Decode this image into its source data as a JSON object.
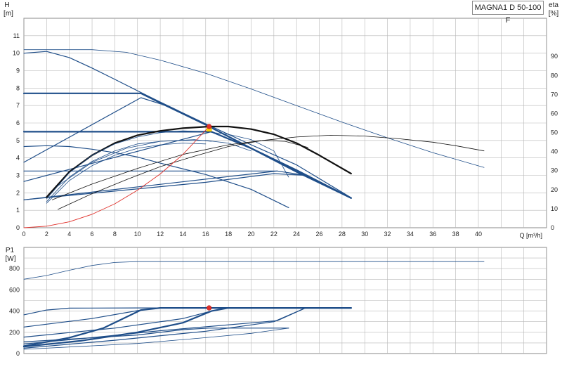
{
  "title": "MAGNA1 D 50-100 F",
  "colors": {
    "grid": "#b8b8b8",
    "axis": "#333333",
    "curve_blue": "#1f4e89",
    "curve_black": "#111111",
    "system_curve": "#e0302a",
    "duty_point": "#e0302a",
    "duty_point_inner": "#ffd400"
  },
  "chart_data": [
    {
      "type": "line",
      "name": "head-chart",
      "xlabel": "Q [m³/h]",
      "ylabel_top": "H",
      "ylabel_unit": "[m]",
      "y2label_top": "eta",
      "y2label_unit": "[%]",
      "xlim": [
        0,
        46
      ],
      "ylim": [
        0,
        12
      ],
      "y2lim": [
        0,
        110
      ],
      "x_ticks": [
        0,
        2,
        4,
        6,
        8,
        10,
        12,
        14,
        16,
        18,
        20,
        22,
        24,
        26,
        28,
        30,
        32,
        34,
        36,
        38,
        40
      ],
      "y_ticks": [
        0,
        1,
        2,
        3,
        4,
        5,
        6,
        7,
        8,
        9,
        10,
        11
      ],
      "y2_ticks": [
        0,
        10,
        20,
        30,
        40,
        50,
        60,
        70,
        80,
        90
      ],
      "grid": true,
      "series": [
        {
          "role": "head",
          "style": "thin",
          "points": [
            [
              0,
              10.2
            ],
            [
              6,
              10.2
            ],
            [
              9,
              10.05
            ],
            [
              12,
              9.6
            ],
            [
              16,
              8.85
            ],
            [
              20,
              7.95
            ],
            [
              24,
              7.0
            ],
            [
              28,
              6.05
            ],
            [
              32,
              5.15
            ],
            [
              36,
              4.3
            ],
            [
              40.5,
              3.45
            ]
          ]
        },
        {
          "role": "head",
          "style": "normal",
          "points": [
            [
              0,
              10.0
            ],
            [
              2,
              10.1
            ],
            [
              4,
              9.75
            ],
            [
              6,
              9.15
            ],
            [
              8,
              8.5
            ],
            [
              10,
              7.85
            ],
            [
              12,
              7.2
            ],
            [
              16,
              5.95
            ],
            [
              20,
              4.75
            ],
            [
              24,
              3.6
            ],
            [
              28.8,
              1.72
            ]
          ]
        },
        {
          "role": "head",
          "style": "normal",
          "points": [
            [
              0,
              4.65
            ],
            [
              2,
              4.7
            ],
            [
              4,
              4.65
            ],
            [
              6,
              4.5
            ],
            [
              8,
              4.3
            ],
            [
              10,
              4.05
            ],
            [
              12,
              3.7
            ],
            [
              16,
              3.05
            ],
            [
              20,
              2.2
            ],
            [
              23.3,
              1.15
            ]
          ]
        },
        {
          "role": "const-pressure",
          "style": "thick",
          "points": [
            [
              0,
              7.7
            ],
            [
              10.3,
              7.7
            ],
            [
              12.5,
              7.0
            ],
            [
              16,
              5.9
            ],
            [
              20,
              4.55
            ],
            [
              24,
              3.2
            ],
            [
              28.8,
              1.7
            ]
          ]
        },
        {
          "role": "const-pressure",
          "style": "thick",
          "points": [
            [
              0,
              5.5
            ],
            [
              16.5,
              5.5
            ],
            [
              20,
              4.55
            ],
            [
              24,
              3.3
            ],
            [
              28.8,
              1.7
            ]
          ]
        },
        {
          "role": "const-pressure",
          "style": "normal",
          "points": [
            [
              0,
              3.25
            ],
            [
              22.3,
              3.25
            ],
            [
              24.8,
              3.0
            ]
          ]
        },
        {
          "role": "prop-pressure",
          "style": "normal",
          "points": [
            [
              0,
              3.75
            ],
            [
              10.3,
              7.45
            ],
            [
              12.5,
              7.0
            ]
          ]
        },
        {
          "role": "prop-pressure",
          "style": "normal",
          "points": [
            [
              0,
              2.65
            ],
            [
              16.5,
              5.5
            ]
          ]
        },
        {
          "role": "prop-pressure",
          "style": "normal",
          "points": [
            [
              0,
              1.6
            ],
            [
              22.3,
              3.25
            ]
          ]
        },
        {
          "role": "prop-pressure",
          "style": "normal",
          "points": [
            [
              0,
              1.6
            ],
            [
              16,
              2.6
            ],
            [
              22,
              3.1
            ],
            [
              24.8,
              3.0
            ]
          ]
        },
        {
          "role": "head",
          "style": "thick",
          "points": [
            [
              2,
              1.75
            ],
            [
              4,
              3.2
            ],
            [
              6,
              4.15
            ],
            [
              8,
              4.85
            ],
            [
              10,
              5.3
            ],
            [
              12,
              5.55
            ],
            [
              14,
              5.7
            ],
            [
              16.3,
              5.8
            ],
            [
              18,
              5.8
            ],
            [
              20,
              5.65
            ],
            [
              22,
              5.35
            ],
            [
              24,
              4.85
            ],
            [
              26,
              4.15
            ],
            [
              28.8,
              3.1
            ]
          ]
        },
        {
          "role": "head",
          "style": "thin",
          "points": [
            [
              2,
              1.65
            ],
            [
              4,
              3.15
            ],
            [
              6,
              4.15
            ],
            [
              8,
              4.8
            ],
            [
              10,
              5.2
            ],
            [
              12,
              5.45
            ],
            [
              14,
              5.55
            ],
            [
              16,
              5.5
            ],
            [
              18,
              5.35
            ],
            [
              20,
              5.05
            ],
            [
              22,
              4.4
            ],
            [
              23.3,
              2.9
            ]
          ]
        },
        {
          "role": "head",
          "style": "thin",
          "points": [
            [
              2,
              1.5
            ],
            [
              4,
              2.9
            ],
            [
              6,
              3.8
            ],
            [
              8,
              4.4
            ],
            [
              10,
              4.8
            ],
            [
              12,
              4.95
            ],
            [
              14,
              5.0
            ],
            [
              16,
              5.0
            ],
            [
              18,
              4.85
            ],
            [
              20,
              4.4
            ]
          ]
        },
        {
          "role": "head",
          "style": "thin",
          "points": [
            [
              2,
              1.4
            ],
            [
              4,
              2.7
            ],
            [
              6,
              3.55
            ],
            [
              8,
              4.15
            ],
            [
              10,
              4.55
            ],
            [
              12,
              4.75
            ],
            [
              14,
              4.85
            ],
            [
              16,
              4.8
            ]
          ]
        },
        {
          "role": "head",
          "style": "thin",
          "points": [
            [
              3,
              2.4
            ],
            [
              6,
              3.75
            ],
            [
              9,
              4.55
            ],
            [
              12,
              4.95
            ],
            [
              15,
              5.05
            ],
            [
              16.5,
              4.95
            ]
          ]
        },
        {
          "role": "eta",
          "style": "thin",
          "points": [
            [
              3,
              1.05
            ],
            [
              6,
              1.95
            ],
            [
              9,
              2.75
            ],
            [
              12,
              3.5
            ],
            [
              15,
              4.1
            ],
            [
              18,
              4.65
            ],
            [
              21,
              5.0
            ],
            [
              24,
              5.2
            ],
            [
              27,
              5.3
            ],
            [
              30,
              5.25
            ],
            [
              33,
              5.1
            ],
            [
              36,
              4.9
            ],
            [
              38,
              4.7
            ],
            [
              40.5,
              4.4
            ]
          ]
        },
        {
          "role": "eta",
          "style": "thin",
          "points": [
            [
              2.5,
              1.6
            ],
            [
              6,
              2.5
            ],
            [
              10,
              3.4
            ],
            [
              14,
              4.2
            ],
            [
              18,
              4.75
            ],
            [
              21,
              5.0
            ],
            [
              23,
              4.95
            ],
            [
              25,
              4.6
            ]
          ]
        },
        {
          "role": "system-curve",
          "style": "red",
          "points": [
            [
              0,
              0
            ],
            [
              2,
              0.09
            ],
            [
              4,
              0.34
            ],
            [
              6,
              0.77
            ],
            [
              8,
              1.37
            ],
            [
              10,
              2.15
            ],
            [
              12,
              3.08
            ],
            [
              14,
              4.2
            ],
            [
              16.3,
              5.8
            ]
          ]
        }
      ],
      "duty_point": {
        "x": 16.3,
        "y": 5.8
      }
    },
    {
      "type": "line",
      "name": "power-chart",
      "ylabel_top": "P1",
      "ylabel_unit": "[W]",
      "xlim": [
        0,
        46
      ],
      "ylim": [
        0,
        1000
      ],
      "x_ticks": [
        0,
        2,
        4,
        6,
        8,
        10,
        12,
        14,
        16,
        18,
        20,
        22,
        24,
        26,
        28,
        30,
        32,
        34,
        36,
        38,
        40
      ],
      "y_ticks": [
        0,
        200,
        400,
        600,
        800
      ],
      "grid": true,
      "series": [
        {
          "role": "power",
          "style": "thin",
          "points": [
            [
              0,
              700
            ],
            [
              2,
              735
            ],
            [
              4,
              785
            ],
            [
              6,
              830
            ],
            [
              8,
              858
            ],
            [
              10,
              866
            ],
            [
              14,
              866
            ],
            [
              20,
              866
            ],
            [
              28,
              866
            ],
            [
              40.5,
              866
            ]
          ]
        },
        {
          "role": "power",
          "style": "normal",
          "points": [
            [
              0,
              365
            ],
            [
              2,
              410
            ],
            [
              4,
              428
            ],
            [
              10,
              430
            ],
            [
              20,
              430
            ],
            [
              28.8,
              430
            ]
          ]
        },
        {
          "role": "power",
          "style": "thick",
          "points": [
            [
              0,
              70
            ],
            [
              4,
              150
            ],
            [
              7,
              240
            ],
            [
              10.3,
              410
            ],
            [
              12,
              430
            ],
            [
              28.8,
              430
            ]
          ]
        },
        {
          "role": "power",
          "style": "thick",
          "points": [
            [
              0,
              65
            ],
            [
              5,
              120
            ],
            [
              10,
              200
            ],
            [
              14,
              290
            ],
            [
              16.5,
              400
            ],
            [
              18,
              430
            ],
            [
              28.8,
              430
            ]
          ]
        },
        {
          "role": "power",
          "style": "normal",
          "points": [
            [
              0,
              250
            ],
            [
              6,
              330
            ],
            [
              10.3,
              410
            ],
            [
              12,
              430
            ]
          ]
        },
        {
          "role": "power",
          "style": "normal",
          "points": [
            [
              0,
              155
            ],
            [
              8,
              240
            ],
            [
              14,
              330
            ],
            [
              16.5,
              400
            ]
          ]
        },
        {
          "role": "power",
          "style": "normal",
          "points": [
            [
              0,
              90
            ],
            [
              6,
              150
            ],
            [
              12,
              215
            ],
            [
              22.3,
              310
            ],
            [
              24.8,
              430
            ]
          ]
        },
        {
          "role": "power",
          "style": "normal",
          "points": [
            [
              0,
              50
            ],
            [
              8,
              125
            ],
            [
              16,
              210
            ],
            [
              22,
              300
            ],
            [
              24.8,
              430
            ]
          ]
        },
        {
          "role": "power",
          "style": "normal",
          "points": [
            [
              0,
              110
            ],
            [
              10,
              175
            ],
            [
              14,
              225
            ],
            [
              16.3,
              240
            ],
            [
              23.3,
              240
            ]
          ]
        },
        {
          "role": "power",
          "style": "thin",
          "points": [
            [
              0,
              40
            ],
            [
              10,
              95
            ],
            [
              16,
              150
            ],
            [
              20,
              190
            ],
            [
              23.3,
              240
            ]
          ]
        }
      ],
      "duty_point": {
        "x": 16.3,
        "y": 430
      }
    }
  ]
}
